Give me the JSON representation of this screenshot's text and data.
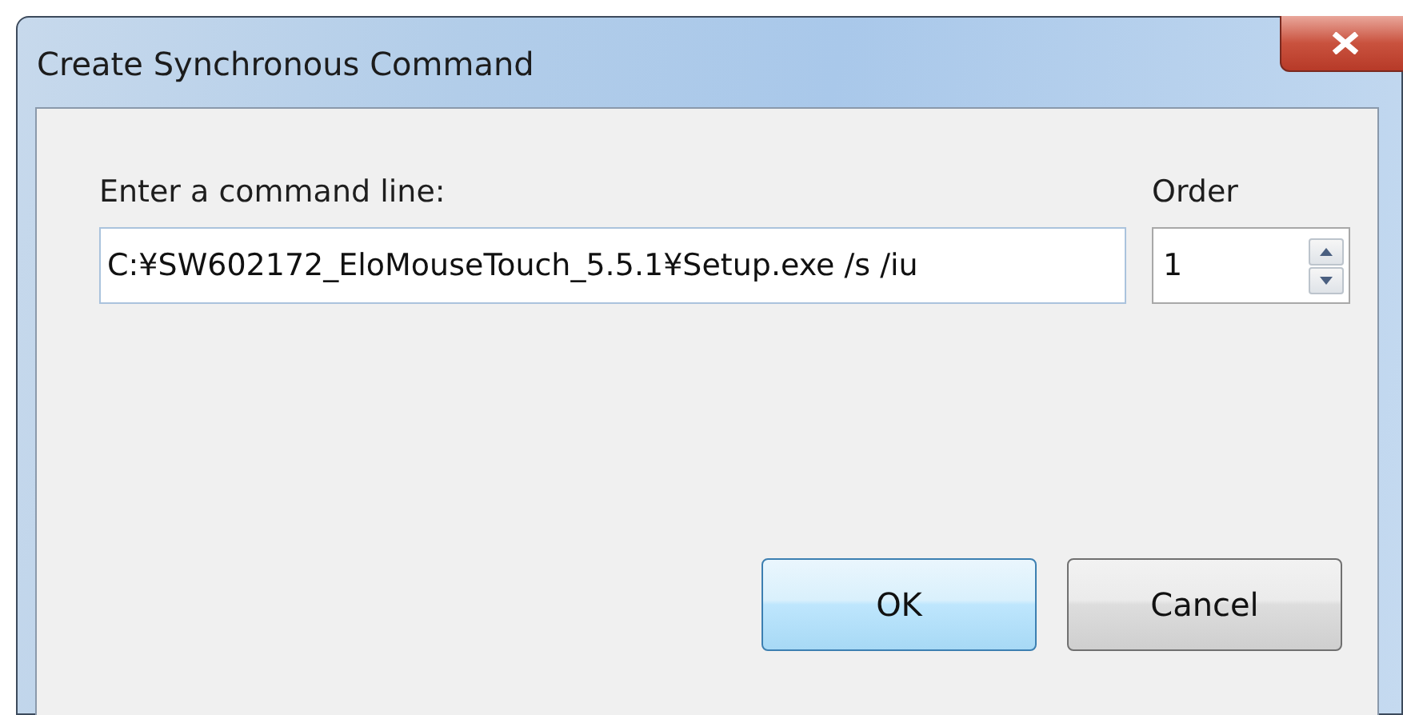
{
  "window": {
    "title": "Create Synchronous Command"
  },
  "command": {
    "label": "Enter a command line:",
    "value": "C:¥SW602172_EloMouseTouch_5.5.1¥Setup.exe /s /iu"
  },
  "order": {
    "label": "Order",
    "value": "1"
  },
  "buttons": [
    {
      "label": "OK",
      "default": true
    },
    {
      "label": "Cancel",
      "default": false
    }
  ]
}
